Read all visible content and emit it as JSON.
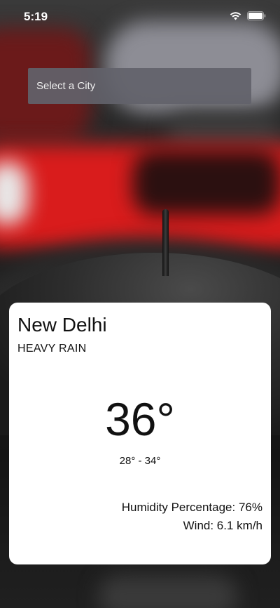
{
  "status_bar": {
    "time": "5:19",
    "icons": [
      "wifi-icon",
      "battery-icon"
    ]
  },
  "city_selector": {
    "placeholder": "Select a City"
  },
  "weather": {
    "city": "New Delhi",
    "condition": "HEAVY RAIN",
    "temperature": "36°",
    "range": "28° - 34°",
    "humidity": "Humidity Percentage: 76%",
    "wind": "Wind: 6.1 km/h"
  },
  "colors": {
    "card_background": "#ffffff",
    "selector_background": "#62626a",
    "text": "#111111"
  }
}
